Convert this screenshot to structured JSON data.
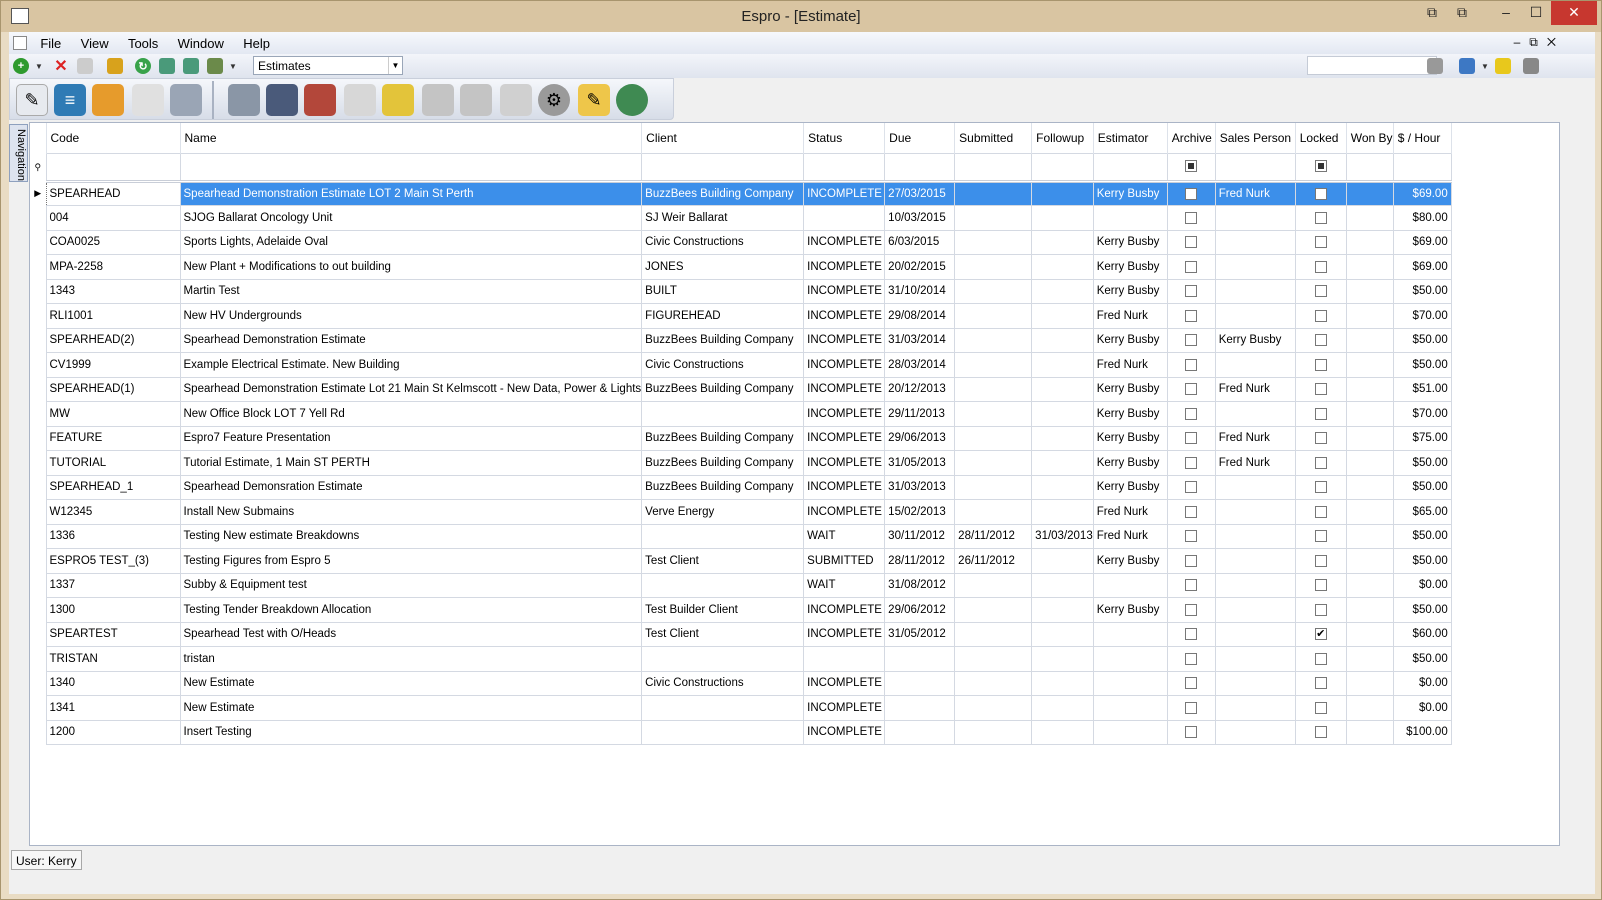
{
  "window": {
    "title": "Espro - [Estimate]"
  },
  "menu": [
    "File",
    "View",
    "Tools",
    "Window",
    "Help"
  ],
  "toolbar": {
    "view_select": "Estimates"
  },
  "navigation_tab": "Navigation",
  "columns": [
    "Code",
    "Name",
    "Client",
    "Status",
    "Due",
    "Submitted",
    "Followup",
    "Estimator",
    "Archive",
    "Sales Person",
    "Locked",
    "Won By",
    "$ / Hour"
  ],
  "rows": [
    {
      "code": "SPEARHEAD",
      "name": "Spearhead Demonstration Estimate LOT 2 Main St Perth",
      "client": "BuzzBees Building Company",
      "status": "INCOMPLETE",
      "due": "27/03/2015",
      "submitted": "",
      "followup": "",
      "estimator": "Kerry Busby",
      "archive": false,
      "sales": "Fred Nurk",
      "locked": false,
      "wonby": "",
      "rate": "$69.00"
    },
    {
      "code": "004",
      "name": "SJOG Ballarat Oncology Unit",
      "client": "SJ Weir Ballarat",
      "status": "",
      "due": "10/03/2015",
      "submitted": "",
      "followup": "",
      "estimator": "",
      "archive": false,
      "sales": "",
      "locked": false,
      "wonby": "",
      "rate": "$80.00"
    },
    {
      "code": "COA0025",
      "name": "Sports Lights, Adelaide Oval",
      "client": "Civic Constructions",
      "status": "INCOMPLETE",
      "due": "6/03/2015",
      "submitted": "",
      "followup": "",
      "estimator": "Kerry Busby",
      "archive": false,
      "sales": "",
      "locked": false,
      "wonby": "",
      "rate": "$69.00"
    },
    {
      "code": "MPA-2258",
      "name": "New Plant + Modifications to out building",
      "client": "JONES",
      "status": "INCOMPLETE",
      "due": "20/02/2015",
      "submitted": "",
      "followup": "",
      "estimator": "Kerry Busby",
      "archive": false,
      "sales": "",
      "locked": false,
      "wonby": "",
      "rate": "$69.00"
    },
    {
      "code": "1343",
      "name": "Martin Test",
      "client": "BUILT",
      "status": "INCOMPLETE",
      "due": "31/10/2014",
      "submitted": "",
      "followup": "",
      "estimator": "Kerry Busby",
      "archive": false,
      "sales": "",
      "locked": false,
      "wonby": "",
      "rate": "$50.00"
    },
    {
      "code": "RLI1001",
      "name": "New HV Undergrounds",
      "client": "FIGUREHEAD",
      "status": "INCOMPLETE",
      "due": "29/08/2014",
      "submitted": "",
      "followup": "",
      "estimator": "Fred Nurk",
      "archive": false,
      "sales": "",
      "locked": false,
      "wonby": "",
      "rate": "$70.00"
    },
    {
      "code": "SPEARHEAD(2)",
      "name": "Spearhead Demonstration Estimate",
      "client": "BuzzBees Building Company",
      "status": "INCOMPLETE",
      "due": "31/03/2014",
      "submitted": "",
      "followup": "",
      "estimator": "Kerry Busby",
      "archive": false,
      "sales": "Kerry Busby",
      "locked": false,
      "wonby": "",
      "rate": "$50.00"
    },
    {
      "code": "CV1999",
      "name": "Example Electrical Estimate. New Building",
      "client": "Civic Constructions",
      "status": "INCOMPLETE",
      "due": "28/03/2014",
      "submitted": "",
      "followup": "",
      "estimator": "Fred Nurk",
      "archive": false,
      "sales": "",
      "locked": false,
      "wonby": "",
      "rate": "$50.00"
    },
    {
      "code": "SPEARHEAD(1)",
      "name": "Spearhead Demonstration Estimate Lot 21 Main St Kelmscott - New Data, Power & Lights",
      "client": "BuzzBees Building Company",
      "status": "INCOMPLETE",
      "due": "20/12/2013",
      "submitted": "",
      "followup": "",
      "estimator": "Kerry Busby",
      "archive": false,
      "sales": "Fred Nurk",
      "locked": false,
      "wonby": "",
      "rate": "$51.00"
    },
    {
      "code": "MW",
      "name": "New Office Block LOT 7 Yell Rd",
      "client": "",
      "status": "INCOMPLETE",
      "due": "29/11/2013",
      "submitted": "",
      "followup": "",
      "estimator": "Kerry Busby",
      "archive": false,
      "sales": "",
      "locked": false,
      "wonby": "",
      "rate": "$70.00"
    },
    {
      "code": "FEATURE",
      "name": "Espro7 Feature Presentation",
      "client": "BuzzBees Building Company",
      "status": "INCOMPLETE",
      "due": "29/06/2013",
      "submitted": "",
      "followup": "",
      "estimator": "Kerry Busby",
      "archive": false,
      "sales": "Fred Nurk",
      "locked": false,
      "wonby": "",
      "rate": "$75.00"
    },
    {
      "code": "TUTORIAL",
      "name": "Tutorial Estimate, 1 Main ST PERTH",
      "client": "BuzzBees Building Company",
      "status": "INCOMPLETE",
      "due": "31/05/2013",
      "submitted": "",
      "followup": "",
      "estimator": "Kerry Busby",
      "archive": false,
      "sales": "Fred Nurk",
      "locked": false,
      "wonby": "",
      "rate": "$50.00"
    },
    {
      "code": "SPEARHEAD_1",
      "name": "Spearhead Demonsration Estimate",
      "client": "BuzzBees Building Company",
      "status": "INCOMPLETE",
      "due": "31/03/2013",
      "submitted": "",
      "followup": "",
      "estimator": "Kerry Busby",
      "archive": false,
      "sales": "",
      "locked": false,
      "wonby": "",
      "rate": "$50.00"
    },
    {
      "code": "W12345",
      "name": "Install New Submains",
      "client": "Verve Energy",
      "status": "INCOMPLETE",
      "due": "15/02/2013",
      "submitted": "",
      "followup": "",
      "estimator": "Fred Nurk",
      "archive": false,
      "sales": "",
      "locked": false,
      "wonby": "",
      "rate": "$65.00"
    },
    {
      "code": "1336",
      "name": "Testing New estimate Breakdowns",
      "client": "",
      "status": "WAIT",
      "due": "30/11/2012",
      "submitted": "28/11/2012",
      "followup": "31/03/2013",
      "estimator": "Fred Nurk",
      "archive": false,
      "sales": "",
      "locked": false,
      "wonby": "",
      "rate": "$50.00"
    },
    {
      "code": "ESPRO5 TEST_(3)",
      "name": "Testing Figures from Espro 5",
      "client": "Test Client",
      "status": "SUBMITTED",
      "due": "28/11/2012",
      "submitted": "26/11/2012",
      "followup": "",
      "estimator": "Kerry Busby",
      "archive": false,
      "sales": "",
      "locked": false,
      "wonby": "",
      "rate": "$50.00"
    },
    {
      "code": "1337",
      "name": "Subby & Equipment test",
      "client": "",
      "status": "WAIT",
      "due": "31/08/2012",
      "submitted": "",
      "followup": "",
      "estimator": "",
      "archive": false,
      "sales": "",
      "locked": false,
      "wonby": "",
      "rate": "$0.00"
    },
    {
      "code": "1300",
      "name": "Testing Tender Breakdown Allocation",
      "client": "Test Builder Client",
      "status": "INCOMPLETE",
      "due": "29/06/2012",
      "submitted": "",
      "followup": "",
      "estimator": "Kerry Busby",
      "archive": false,
      "sales": "",
      "locked": false,
      "wonby": "",
      "rate": "$50.00"
    },
    {
      "code": "SPEARTEST",
      "name": "Spearhead Test with O/Heads",
      "client": "Test Client",
      "status": "INCOMPLETE",
      "due": "31/05/2012",
      "submitted": "",
      "followup": "",
      "estimator": "",
      "archive": false,
      "sales": "",
      "locked": true,
      "wonby": "",
      "rate": "$60.00"
    },
    {
      "code": "TRISTAN",
      "name": "tristan",
      "client": "",
      "status": "",
      "due": "",
      "submitted": "",
      "followup": "",
      "estimator": "",
      "archive": false,
      "sales": "",
      "locked": false,
      "wonby": "",
      "rate": "$50.00"
    },
    {
      "code": "1340",
      "name": "New Estimate",
      "client": "Civic Constructions",
      "status": "INCOMPLETE",
      "due": "",
      "submitted": "",
      "followup": "",
      "estimator": "",
      "archive": false,
      "sales": "",
      "locked": false,
      "wonby": "",
      "rate": "$0.00"
    },
    {
      "code": "1341",
      "name": "New Estimate",
      "client": "",
      "status": "INCOMPLETE",
      "due": "",
      "submitted": "",
      "followup": "",
      "estimator": "",
      "archive": false,
      "sales": "",
      "locked": false,
      "wonby": "",
      "rate": "$0.00"
    },
    {
      "code": "1200",
      "name": "Insert Testing",
      "client": "",
      "status": "INCOMPLETE",
      "due": "",
      "submitted": "",
      "followup": "",
      "estimator": "",
      "archive": false,
      "sales": "",
      "locked": false,
      "wonby": "",
      "rate": "$100.00"
    }
  ],
  "selected_row": 0,
  "status": {
    "user": "User: Kerry"
  }
}
